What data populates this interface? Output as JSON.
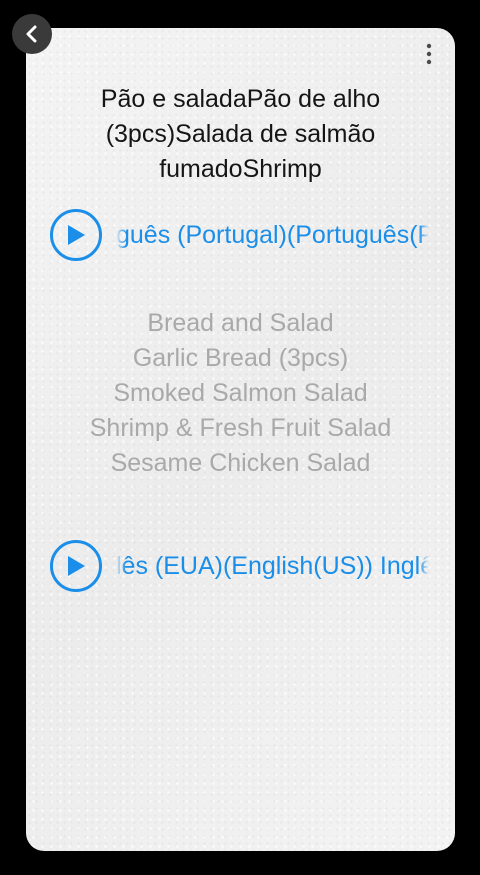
{
  "header": {
    "title": "Pão e saladaPão de alho\n(3pcs)Salada de salmão\nfumadoShrimp"
  },
  "audio": [
    {
      "label": "guês (Portugal)(Português(Portugal))",
      "icon": "play-icon"
    },
    {
      "label": "lês (EUA)(English(US))  Inglês (EUA)",
      "icon": "play-icon"
    }
  ],
  "menu": {
    "items": [
      "Bread and Salad",
      "Garlic Bread (3pcs)",
      "Smoked Salmon Salad",
      "Shrimp & Fresh Fruit Salad",
      "Sesame Chicken Salad"
    ]
  },
  "colors": {
    "accent": "#1a8ee8",
    "secondary_text": "#a9a9a9",
    "card_bg": "#f1f1f1"
  }
}
